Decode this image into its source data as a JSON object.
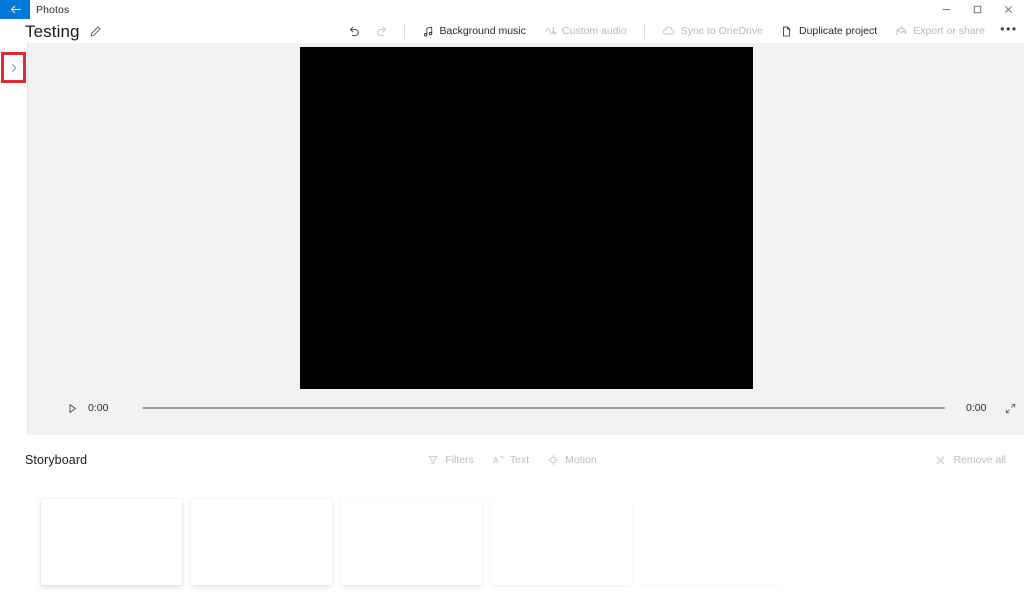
{
  "titlebar": {
    "back_label": "back-arrow",
    "app_name": "Photos",
    "window_controls": [
      {
        "name": "minimize",
        "glyph": "minimize"
      },
      {
        "name": "maximize",
        "glyph": "restore"
      },
      {
        "name": "close",
        "glyph": "close"
      }
    ],
    "accent_color": "#0078d7"
  },
  "commandbar": {
    "project_title": "Testing",
    "edit_title_icon": "pencil-icon",
    "undo": {
      "label": "Undo",
      "icon": "undo-icon",
      "disabled": false
    },
    "redo": {
      "label": "Redo",
      "icon": "redo-icon",
      "disabled": true
    },
    "items": [
      {
        "label": "Background music",
        "icon": "music-note-icon",
        "disabled": false
      },
      {
        "label": "Custom audio",
        "icon": "custom-audio-icon",
        "disabled": true
      },
      {
        "label": "Sync to OneDrive",
        "icon": "cloud-icon",
        "disabled": true
      },
      {
        "label": "Duplicate project",
        "icon": "copy-icon",
        "disabled": false
      },
      {
        "label": "Export or share",
        "icon": "share-icon",
        "disabled": true
      }
    ],
    "overflow_label": "•••"
  },
  "stage": {
    "expand_panel_icon": "chevron-right-icon",
    "expand_panel_highlight_color": "#e02a32",
    "preview_background": "#000000",
    "background_color": "#f2f2f2"
  },
  "playback": {
    "play_icon": "play-icon",
    "current_time": "0:00",
    "total_time": "0:00",
    "fullscreen_icon": "fullscreen-icon",
    "progress_percent": 0
  },
  "storyboard": {
    "title": "Storyboard",
    "tools": [
      {
        "label": "Filters",
        "icon": "filters-icon",
        "disabled": true
      },
      {
        "label": "Text",
        "icon": "text-icon",
        "disabled": true
      },
      {
        "label": "Motion",
        "icon": "motion-icon",
        "disabled": true
      }
    ],
    "remove_all": {
      "label": "Remove all",
      "icon": "close-x-icon",
      "disabled": true
    },
    "cards": [
      {
        "index": 0
      },
      {
        "index": 1
      },
      {
        "index": 2
      },
      {
        "index": 3
      },
      {
        "index": 4
      }
    ]
  }
}
